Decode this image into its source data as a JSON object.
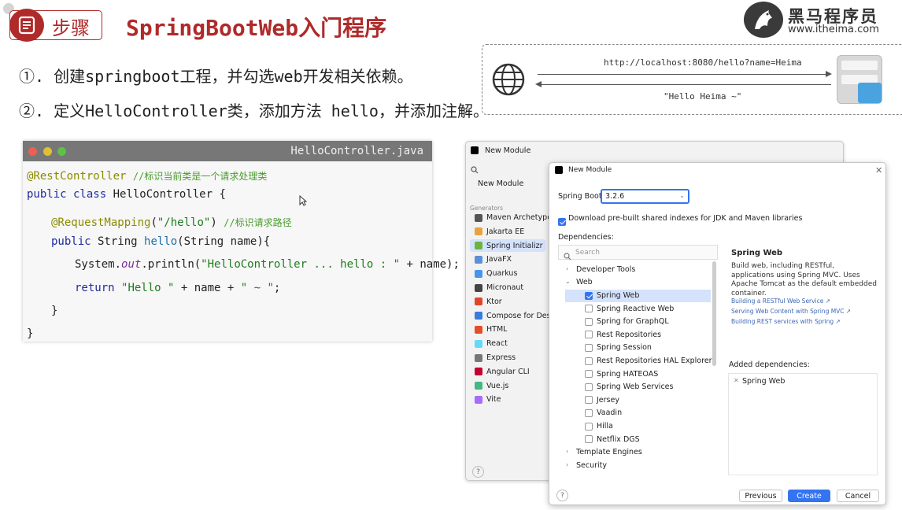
{
  "header": {
    "step_label": "步骤",
    "title": "SpringBootWeb入门程序",
    "logo_name": "黑马程序员",
    "logo_url": "www.itheima.com"
  },
  "points": [
    "①. 创建springboot工程，并勾选web开发相关依赖。",
    "②. 定义HelloController类，添加方法 hello，并添加注解。"
  ],
  "http_diagram": {
    "request_url": "http://localhost:8080/hello?name=Heima",
    "response_text": "\"Hello Heima ~\""
  },
  "code_window": {
    "filename": "HelloController.java",
    "annotation_rest": "@RestController",
    "comment_rest": "//标识当前类是一个请求处理类",
    "class_decl_kw": "public class",
    "class_decl_name": " HelloController {",
    "annotation_mapping": "@RequestMapping",
    "mapping_open": "(",
    "mapping_path": "\"/hello\"",
    "mapping_close": ")",
    "comment_mapping": "//标识请求路径",
    "method_kw": "public",
    "method_ret": " String ",
    "method_name": "hello",
    "method_params": "(String name){",
    "println_prefix": "System.",
    "println_out": "out",
    "println_mid": ".println(",
    "println_str": "\"HelloController ... hello : \"",
    "println_end": " + name);",
    "return_kw": "return",
    "return_str1": "\"Hello \"",
    "return_mid": " + name + ",
    "return_str2": "\" ~ \"",
    "return_end": ";",
    "close_method": "}",
    "close_class": "}"
  },
  "ide": {
    "window_title": "New Module",
    "sidebar_selected": "New Module",
    "generators_label": "Generators",
    "generators": [
      {
        "label": "Maven Archetype",
        "icon": "maven-icon",
        "color": "#555"
      },
      {
        "label": "Jakarta EE",
        "icon": "jakarta-icon",
        "color": "#e8a33d"
      },
      {
        "label": "Spring Initializr",
        "icon": "spring-icon",
        "color": "#6db33f"
      },
      {
        "label": "JavaFX",
        "icon": "javafx-icon",
        "color": "#5b8fd6"
      },
      {
        "label": "Quarkus",
        "icon": "quarkus-icon",
        "color": "#4695eb"
      },
      {
        "label": "Micronaut",
        "icon": "micronaut-icon",
        "color": "#444"
      },
      {
        "label": "Ktor",
        "icon": "ktor-icon",
        "color": "#e0452b"
      },
      {
        "label": "Compose for Deskt",
        "icon": "compose-icon",
        "color": "#3a7be0"
      },
      {
        "label": "HTML",
        "icon": "html-icon",
        "color": "#e44d26"
      },
      {
        "label": "React",
        "icon": "react-icon",
        "color": "#61dafb"
      },
      {
        "label": "Express",
        "icon": "express-icon",
        "color": "#777"
      },
      {
        "label": "Angular CLI",
        "icon": "angular-icon",
        "color": "#c3002f"
      },
      {
        "label": "Vue.js",
        "icon": "vue-icon",
        "color": "#42b883"
      },
      {
        "label": "Vite",
        "icon": "vite-icon",
        "color": "#a66bff"
      }
    ]
  },
  "dialog": {
    "title": "New Module",
    "spring_boot_label": "Spring Boot:",
    "spring_boot_value": "3.2.6",
    "download_label": "Download pre-built shared indexes for JDK and Maven libraries",
    "dependencies_label": "Dependencies:",
    "search_placeholder": "Search",
    "tree": {
      "developer_tools": "Developer Tools",
      "web": "Web",
      "template_engines": "Template Engines",
      "security": "Security"
    },
    "web_deps": [
      {
        "label": "Spring Web",
        "checked": true
      },
      {
        "label": "Spring Reactive Web",
        "checked": false
      },
      {
        "label": "Spring for GraphQL",
        "checked": false
      },
      {
        "label": "Rest Repositories",
        "checked": false
      },
      {
        "label": "Spring Session",
        "checked": false
      },
      {
        "label": "Rest Repositories HAL Explorer",
        "checked": false
      },
      {
        "label": "Spring HATEOAS",
        "checked": false
      },
      {
        "label": "Spring Web Services",
        "checked": false
      },
      {
        "label": "Jersey",
        "checked": false
      },
      {
        "label": "Vaadin",
        "checked": false
      },
      {
        "label": "Hilla",
        "checked": false
      },
      {
        "label": "Netflix DGS",
        "checked": false
      }
    ],
    "detail": {
      "title": "Spring Web",
      "description": "Build web, including RESTful, applications using Spring MVC. Uses Apache Tomcat as the default embedded container.",
      "links": [
        "Building a RESTful Web Service ↗",
        "Serving Web Content with Spring MVC ↗",
        "Building REST services with Spring ↗"
      ]
    },
    "added_label": "Added dependencies:",
    "added_items": [
      "Spring Web"
    ],
    "buttons": {
      "previous": "Previous",
      "create": "Create",
      "cancel": "Cancel"
    },
    "help": "?"
  },
  "colors": {
    "brand_red": "#b02a2a",
    "ide_blue": "#3574f0",
    "code_bar": "#777777"
  }
}
